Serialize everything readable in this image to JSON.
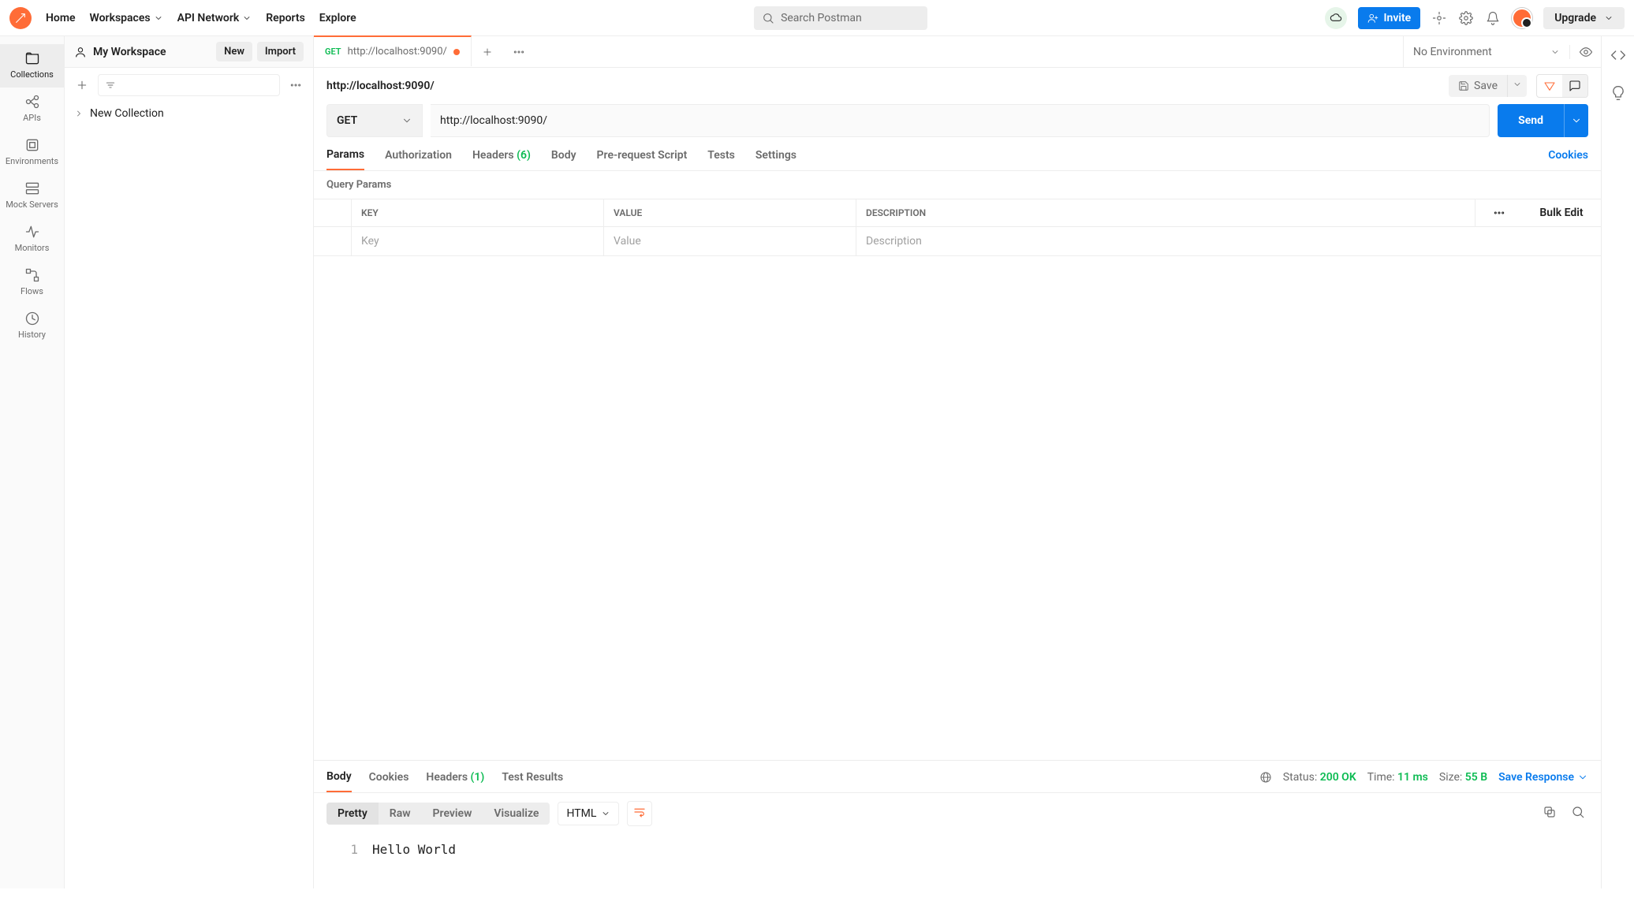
{
  "topnav": {
    "items": [
      "Home",
      "Workspaces",
      "API Network",
      "Reports",
      "Explore"
    ],
    "search_placeholder": "Search Postman",
    "invite_label": "Invite",
    "upgrade_label": "Upgrade"
  },
  "workspace": {
    "name": "My Workspace",
    "new_label": "New",
    "import_label": "Import"
  },
  "rail": {
    "items": [
      "Collections",
      "APIs",
      "Environments",
      "Mock Servers",
      "Monitors",
      "Flows",
      "History"
    ],
    "active_index": 0
  },
  "sidebar": {
    "tree": [
      {
        "label": "New Collection"
      }
    ]
  },
  "tabs": {
    "open": [
      {
        "method": "GET",
        "title": "http://localhost:9090/",
        "dirty": true
      }
    ],
    "environment": "No Environment"
  },
  "request": {
    "title": "http://localhost:9090/",
    "save_label": "Save",
    "method": "GET",
    "url": "http://localhost:9090/",
    "send_label": "Send",
    "tab_labels": {
      "params": "Params",
      "authorization": "Authorization",
      "headers": "Headers",
      "headers_count": "(6)",
      "body": "Body",
      "prerequest": "Pre-request Script",
      "tests": "Tests",
      "settings": "Settings",
      "cookies": "Cookies"
    },
    "query_params_label": "Query Params",
    "columns": {
      "key": "KEY",
      "value": "VALUE",
      "description": "DESCRIPTION",
      "bulk": "Bulk Edit"
    },
    "placeholder_row": {
      "key": "Key",
      "value": "Value",
      "description": "Description"
    }
  },
  "response": {
    "tab_labels": {
      "body": "Body",
      "cookies": "Cookies",
      "headers": "Headers",
      "headers_count": "(1)",
      "testresults": "Test Results"
    },
    "meta": {
      "status_label": "Status:",
      "status": "200 OK",
      "time_label": "Time:",
      "time": "11 ms",
      "size_label": "Size:",
      "size": "55 B",
      "save_label": "Save Response"
    },
    "view_tabs": {
      "pretty": "Pretty",
      "raw": "Raw",
      "preview": "Preview",
      "visualize": "Visualize"
    },
    "content_type": "HTML",
    "body_lines": [
      {
        "n": "1",
        "text": "Hello World"
      }
    ]
  }
}
